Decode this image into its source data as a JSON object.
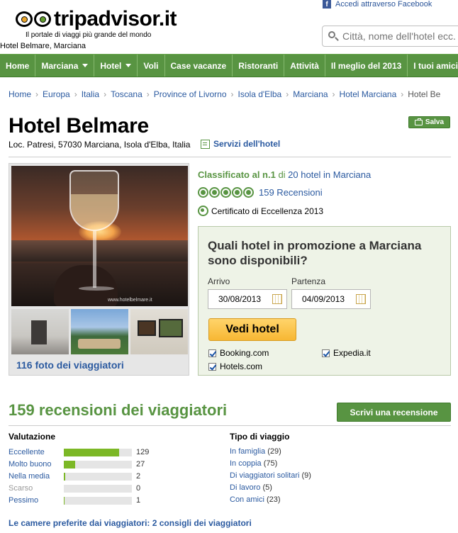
{
  "header": {
    "logo_main": "tripadvisor",
    "logo_tld": ".it",
    "tagline": "Il portale di viaggi più grande del mondo",
    "location_label": "Hotel Belmare, Marciana",
    "facebook_label": "Accedi attraverso Facebook",
    "search_placeholder": "Città, nome dell'hotel ecc."
  },
  "nav": {
    "items": [
      {
        "label": "Home",
        "dropdown": false
      },
      {
        "label": "Marciana",
        "dropdown": true
      },
      {
        "label": "Hotel",
        "dropdown": true
      },
      {
        "label": "Voli",
        "dropdown": false
      },
      {
        "label": "Case vacanze",
        "dropdown": false
      },
      {
        "label": "Ristoranti",
        "dropdown": false
      },
      {
        "label": "Attività",
        "dropdown": false
      },
      {
        "label": "Il meglio del 2013",
        "dropdown": false
      },
      {
        "label": "I tuoi amici",
        "dropdown": false
      }
    ]
  },
  "breadcrumb": [
    "Home",
    "Europa",
    "Italia",
    "Toscana",
    "Province of Livorno",
    "Isola d'Elba",
    "Marciana",
    "Hotel Marciana",
    "Hotel Be"
  ],
  "hotel": {
    "name": "Hotel Belmare",
    "address": "Loc. Patresi, 57030 Marciana, Isola d'Elba, Italia",
    "services_label": "Servizi dell'hotel",
    "save_label": "Salva",
    "photos_label": "116 foto dei viaggiatori",
    "photo_watermark": "www.hotelbelmare.it"
  },
  "ranking": {
    "prefix": "Classificato al n.1",
    "of": " di ",
    "count_link": "20 hotel in Marciana",
    "bubble_rating": 5,
    "reviews_link": "159 Recensioni",
    "certificate": "Certificato di Eccellenza 2013"
  },
  "promo": {
    "title": "Quali hotel in promozione a Marciana sono disponibili?",
    "arrival_label": "Arrivo",
    "arrival_value": "30/08/2013",
    "departure_label": "Partenza",
    "departure_value": "04/09/2013",
    "button_label": "Vedi hotel",
    "providers": [
      {
        "name": "Booking.com",
        "checked": true
      },
      {
        "name": "Expedia.it",
        "checked": true
      },
      {
        "name": "Hotels.com",
        "checked": true
      }
    ]
  },
  "reviews": {
    "title": "159 recensioni dei viaggiatori",
    "write_button": "Scrivi una recensione",
    "rating_header": "Valutazione",
    "trip_header": "Tipo di viaggio",
    "ratings": [
      {
        "label": "Eccellente",
        "count": 129,
        "fraction": 0.81,
        "enabled": true
      },
      {
        "label": "Molto buono",
        "count": 27,
        "fraction": 0.17,
        "enabled": true
      },
      {
        "label": "Nella media",
        "count": 2,
        "fraction": 0.02,
        "enabled": true
      },
      {
        "label": "Scarso",
        "count": 0,
        "fraction": 0,
        "enabled": false
      },
      {
        "label": "Pessimo",
        "count": 1,
        "fraction": 0.01,
        "enabled": true
      }
    ],
    "trip_types": [
      {
        "label": "In famiglia",
        "count": "(29)"
      },
      {
        "label": "In coppia",
        "count": "(75)"
      },
      {
        "label": "Di viaggiatori solitari",
        "count": "(9)"
      },
      {
        "label": "Di lavoro",
        "count": "(5)"
      },
      {
        "label": "Con amici",
        "count": "(23)"
      }
    ],
    "rooms_link": "Le camere preferite dai viaggiatori: 2 consigli dei viaggiatori"
  },
  "colors": {
    "brand_green": "#589442",
    "link_blue": "#2b5aa0",
    "bar_green": "#7cb826",
    "button_yellow": "#f7b733"
  }
}
